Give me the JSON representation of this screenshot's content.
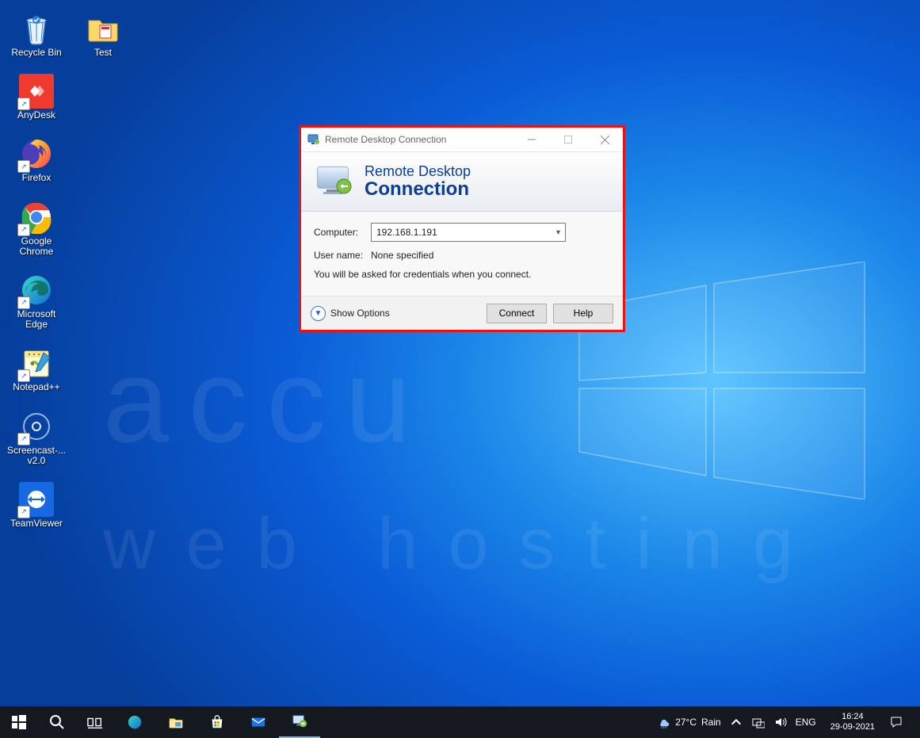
{
  "desktop_icons": {
    "recycle_bin": "Recycle Bin",
    "test": "Test",
    "anydesk": "AnyDesk",
    "firefox": "Firefox",
    "chrome": "Google Chrome",
    "edge": "Microsoft Edge",
    "notepadpp": "Notepad++",
    "screencast": "Screencast-... v2.0",
    "teamviewer": "TeamViewer"
  },
  "watermark": {
    "line1": "accu",
    "line2": "web hosting"
  },
  "dialog": {
    "title": "Remote Desktop Connection",
    "banner_line1": "Remote Desktop",
    "banner_line2": "Connection",
    "computer_label": "Computer:",
    "computer_value": "192.168.1.191",
    "username_label": "User name:",
    "username_value": "None specified",
    "hint": "You will be asked for credentials when you connect.",
    "show_options": "Show Options",
    "connect": "Connect",
    "help": "Help"
  },
  "taskbar": {
    "weather_temp": "27°C",
    "weather_text": "Rain",
    "lang": "ENG",
    "time": "16:24",
    "date": "29-09-2021"
  }
}
